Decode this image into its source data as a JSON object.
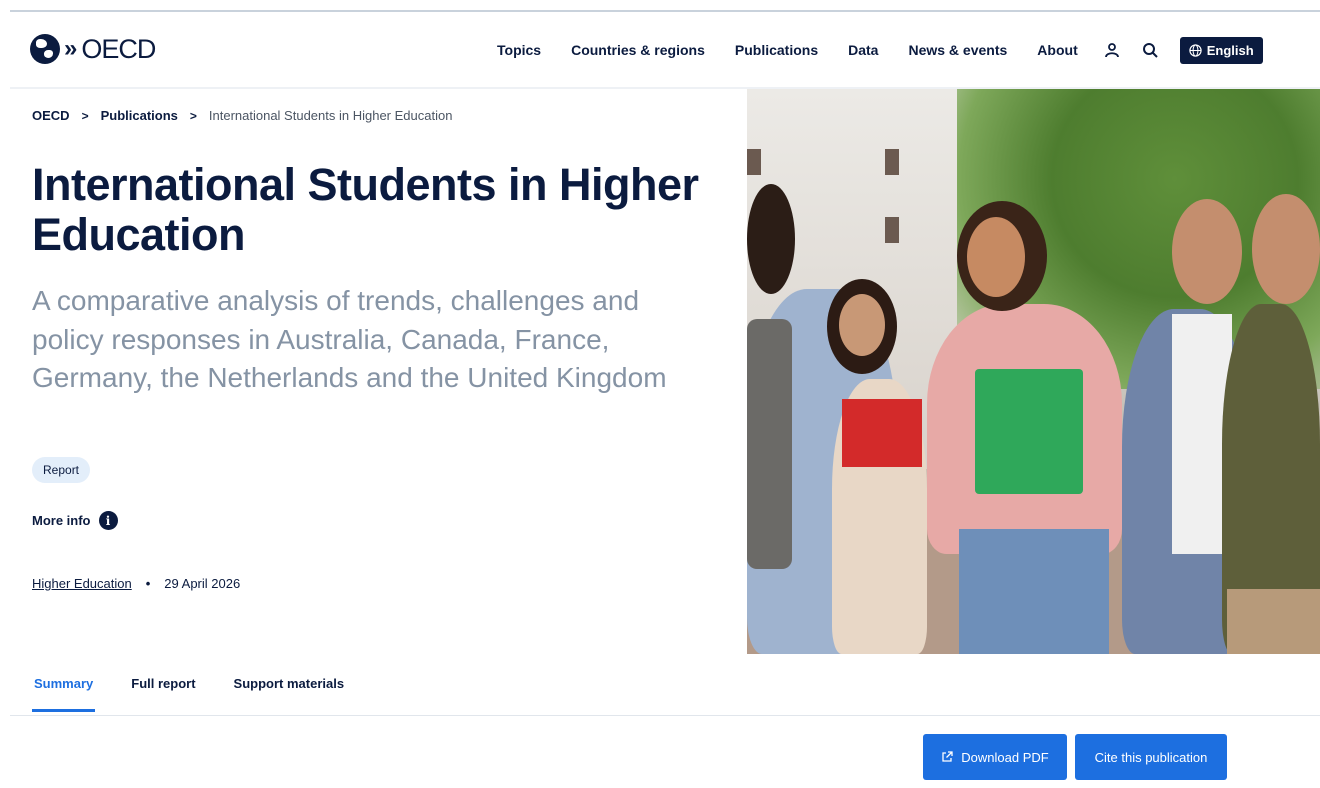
{
  "header": {
    "logo_text": "OECD",
    "nav": [
      "Topics",
      "Countries & regions",
      "Publications",
      "Data",
      "News & events",
      "About"
    ],
    "language": "English",
    "icons": [
      "user-icon",
      "search-icon",
      "globe-icon"
    ]
  },
  "breadcrumb": {
    "home": "OECD",
    "section": "Publications",
    "current": "International Students in Higher Education"
  },
  "page": {
    "title": "International Students in Higher Education",
    "subtitle": "A comparative analysis of trends, challenges and policy responses in Australia, Canada, France, Germany, the Netherlands and the United Kingdom",
    "badge": "Report",
    "more_info": "More info",
    "topic_link": "Higher Education",
    "date": "29 April 2026"
  },
  "tabs": [
    {
      "label": "Summary",
      "active": true
    },
    {
      "label": "Full report",
      "active": false
    },
    {
      "label": "Support materials",
      "active": false
    }
  ],
  "actions": {
    "download": "Download PDF",
    "cite": "Cite this publication"
  },
  "colors": {
    "navy": "#0b1b3f",
    "accent": "#1d6fe0",
    "subtitle_gray": "#8593a4",
    "badge_bg": "#e3eefa"
  }
}
